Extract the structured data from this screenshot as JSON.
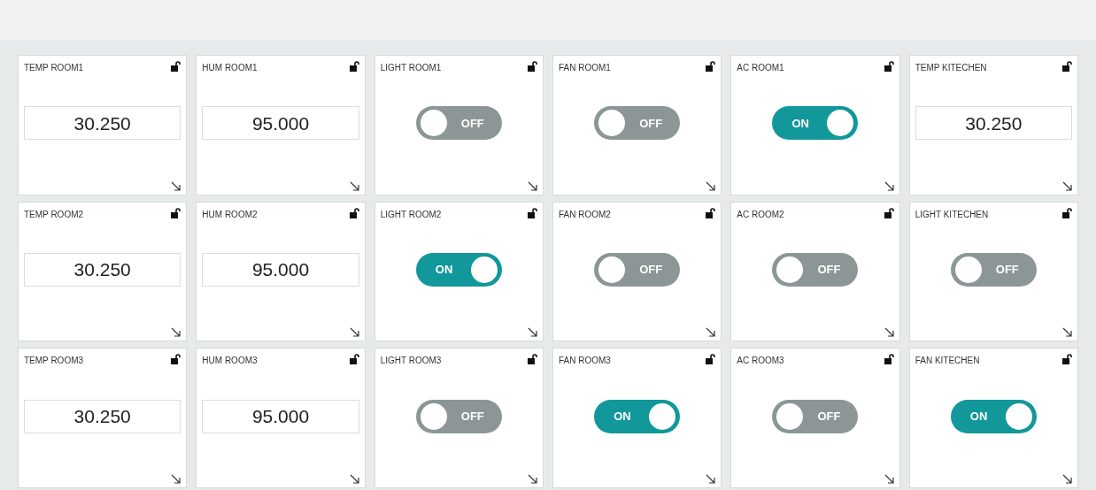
{
  "widgets": [
    {
      "title": "TEMP ROOM1",
      "kind": "value",
      "value": "30.250"
    },
    {
      "title": "HUM ROOM1",
      "kind": "value",
      "value": "95.000"
    },
    {
      "title": "LIGHT ROOM1",
      "kind": "switch",
      "on": false,
      "state_label": "OFF"
    },
    {
      "title": "FAN ROOM1",
      "kind": "switch",
      "on": false,
      "state_label": "OFF"
    },
    {
      "title": "AC ROOM1",
      "kind": "switch",
      "on": true,
      "state_label": "ON"
    },
    {
      "title": "TEMP KITECHEN",
      "kind": "value",
      "value": "30.250"
    },
    {
      "title": "TEMP ROOM2",
      "kind": "value",
      "value": "30.250"
    },
    {
      "title": "HUM ROOM2",
      "kind": "value",
      "value": "95.000"
    },
    {
      "title": "LIGHT ROOM2",
      "kind": "switch",
      "on": true,
      "state_label": "ON"
    },
    {
      "title": "FAN ROOM2",
      "kind": "switch",
      "on": false,
      "state_label": "OFF"
    },
    {
      "title": "AC ROOM2",
      "kind": "switch",
      "on": false,
      "state_label": "OFF"
    },
    {
      "title": "LIGHT KITECHEN",
      "kind": "switch",
      "on": false,
      "state_label": "OFF"
    },
    {
      "title": "TEMP ROOM3",
      "kind": "value",
      "value": "30.250"
    },
    {
      "title": "HUM ROOM3",
      "kind": "value",
      "value": "95.000"
    },
    {
      "title": "LIGHT ROOM3",
      "kind": "switch",
      "on": false,
      "state_label": "OFF"
    },
    {
      "title": "FAN ROOM3",
      "kind": "switch",
      "on": true,
      "state_label": "ON"
    },
    {
      "title": "AC ROOM3",
      "kind": "switch",
      "on": false,
      "state_label": "OFF"
    },
    {
      "title": "FAN KITECHEN",
      "kind": "switch",
      "on": true,
      "state_label": "ON"
    }
  ]
}
